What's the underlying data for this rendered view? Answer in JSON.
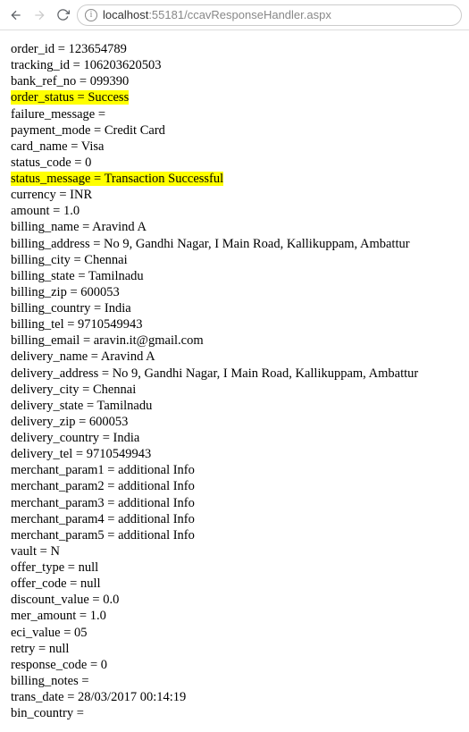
{
  "toolbar": {
    "url_host": "localhost",
    "url_port": ":55181",
    "url_path": "/ccavResponseHandler.aspx"
  },
  "highlighted_keys": [
    "order_status",
    "status_message"
  ],
  "pairs": [
    {
      "key": "order_id",
      "value": "123654789"
    },
    {
      "key": "tracking_id",
      "value": "106203620503"
    },
    {
      "key": "bank_ref_no",
      "value": "099390"
    },
    {
      "key": "order_status",
      "value": "Success"
    },
    {
      "key": "failure_message",
      "value": ""
    },
    {
      "key": "payment_mode",
      "value": "Credit Card"
    },
    {
      "key": "card_name",
      "value": "Visa"
    },
    {
      "key": "status_code",
      "value": "0"
    },
    {
      "key": "status_message",
      "value": "Transaction Successful"
    },
    {
      "key": "currency",
      "value": "INR"
    },
    {
      "key": "amount",
      "value": "1.0"
    },
    {
      "key": "billing_name",
      "value": "Aravind A"
    },
    {
      "key": "billing_address",
      "value": "No 9, Gandhi Nagar, I Main Road, Kallikuppam, Ambattur"
    },
    {
      "key": "billing_city",
      "value": "Chennai"
    },
    {
      "key": "billing_state",
      "value": "Tamilnadu"
    },
    {
      "key": "billing_zip",
      "value": "600053"
    },
    {
      "key": "billing_country",
      "value": "India"
    },
    {
      "key": "billing_tel",
      "value": "9710549943"
    },
    {
      "key": "billing_email",
      "value": "aravin.it@gmail.com"
    },
    {
      "key": "delivery_name",
      "value": "Aravind A"
    },
    {
      "key": "delivery_address",
      "value": "No 9, Gandhi Nagar, I Main Road, Kallikuppam, Ambattur"
    },
    {
      "key": "delivery_city",
      "value": "Chennai"
    },
    {
      "key": "delivery_state",
      "value": "Tamilnadu"
    },
    {
      "key": "delivery_zip",
      "value": "600053"
    },
    {
      "key": "delivery_country",
      "value": "India"
    },
    {
      "key": "delivery_tel",
      "value": "9710549943"
    },
    {
      "key": "merchant_param1",
      "value": "additional Info"
    },
    {
      "key": "merchant_param2",
      "value": "additional Info"
    },
    {
      "key": "merchant_param3",
      "value": "additional Info"
    },
    {
      "key": "merchant_param4",
      "value": "additional Info"
    },
    {
      "key": "merchant_param5",
      "value": "additional Info"
    },
    {
      "key": "vault",
      "value": "N"
    },
    {
      "key": "offer_type",
      "value": "null"
    },
    {
      "key": "offer_code",
      "value": "null"
    },
    {
      "key": "discount_value",
      "value": "0.0"
    },
    {
      "key": "mer_amount",
      "value": "1.0"
    },
    {
      "key": "eci_value",
      "value": "05"
    },
    {
      "key": "retry",
      "value": "null"
    },
    {
      "key": "response_code",
      "value": "0"
    },
    {
      "key": "billing_notes",
      "value": ""
    },
    {
      "key": "trans_date",
      "value": "28/03/2017 00:14:19"
    },
    {
      "key": "bin_country",
      "value": ""
    }
  ]
}
